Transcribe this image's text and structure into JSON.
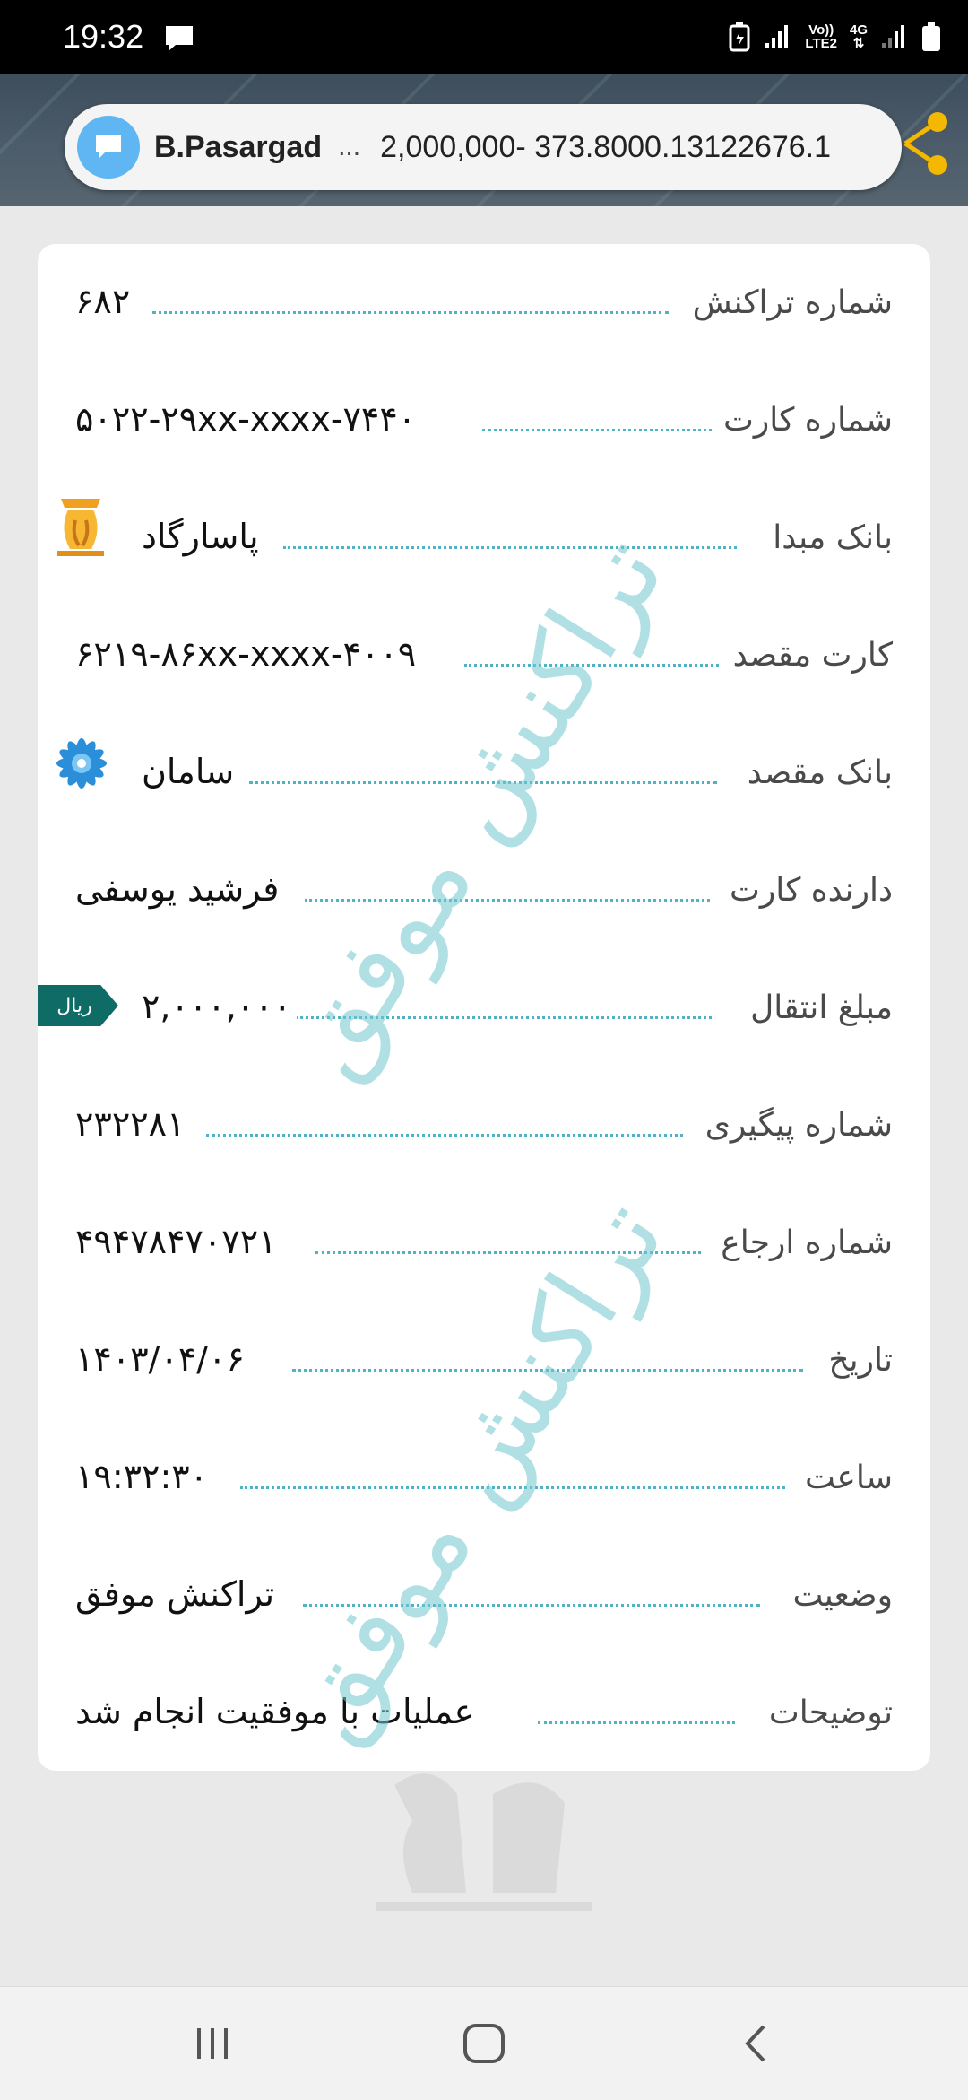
{
  "status_bar": {
    "time": "19:32",
    "network_label_top": "Vo))",
    "network_label_bottom": "LTE2",
    "network_type": "4G"
  },
  "notification": {
    "sender": "B.Pasargad",
    "ellipsis": "...",
    "text": "2,000,000- 373.8000.13122676.1"
  },
  "receipt": {
    "rows": [
      {
        "label": "شماره تراکنش",
        "value": "۶۸۲"
      },
      {
        "label": "شماره کارت",
        "value": "۵۰۲۲-۲۹xx-xxxx-۷۴۴۰"
      },
      {
        "label": "بانک مبدا",
        "value": "پاسارگاد",
        "logo": "pasargad-logo"
      },
      {
        "label": "کارت مقصد",
        "value": "۶۲۱۹-۸۶xx-xxxx-۴۰۰۹"
      },
      {
        "label": "بانک مقصد",
        "value": "سامان",
        "logo": "saman-logo"
      },
      {
        "label": "دارنده کارت",
        "value": "فرشید یوسفی"
      },
      {
        "label": "مبلغ انتقال",
        "value": "۲,۰۰۰,۰۰۰",
        "badge": "ریال"
      },
      {
        "label": "شماره پیگیری",
        "value": "۲۳۲۲۸۱"
      },
      {
        "label": "شماره ارجاع",
        "value": "۴۹۴۷۸۴۷۰۷۲۱"
      },
      {
        "label": "تاریخ",
        "value": "۱۴۰۳/۰۴/۰۶"
      },
      {
        "label": "ساعت",
        "value": "۱۹:۳۲:۳۰"
      },
      {
        "label": "وضعیت",
        "value": "تراکنش موفق"
      },
      {
        "label": "توضیحات",
        "value": "عملیات با موفقیت انجام شد"
      }
    ],
    "watermark": "تراکنش موفق"
  },
  "colors": {
    "accent_dots": "#4fb3c6",
    "badge": "#0f6b66",
    "avatar": "#5fb6f2"
  }
}
